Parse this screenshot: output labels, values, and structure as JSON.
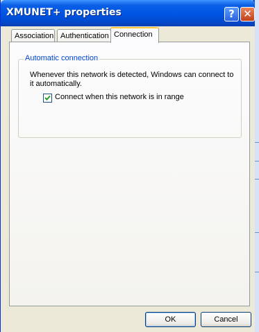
{
  "window": {
    "title": "XMUNET+ properties",
    "help_label": "?",
    "close_label": "✕"
  },
  "tabs": [
    {
      "label": "Association",
      "active": false
    },
    {
      "label": "Authentication",
      "active": false
    },
    {
      "label": "Connection",
      "active": true
    }
  ],
  "group": {
    "title": "Automatic connection",
    "description": "Whenever this network is detected, Windows can connect to it automatically.",
    "checkbox_label": "Connect when this network is in range",
    "checkbox_checked": true
  },
  "buttons": {
    "ok": "OK",
    "cancel": "Cancel"
  },
  "colors": {
    "titlebar": "#0054e3",
    "group_title": "#0046d5",
    "active_tab_highlight": "#ffc83c",
    "checkmark": "#21a121"
  },
  "icons": [
    "help-icon",
    "close-icon",
    "checkmark-icon"
  ]
}
